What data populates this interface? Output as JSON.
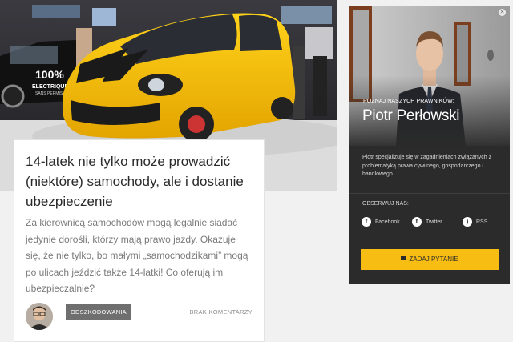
{
  "article": {
    "title": "14-latek nie tylko może prowadzić (niektóre) samochody, ale i dostanie ubezpieczenie",
    "excerpt": "Za kierownicą samochodów mogą legalnie siadać jedynie dorośli, którzy mają prawo jazdy. Okazuje się, że nie tylko, bo małymi „samochodzikami” mogą po ulicach jeździć także 14-latki! Co oferują im ubezpieczalnie?",
    "category": "ODSZKODOWANIA",
    "comments": "BRAK KOMENTARZY",
    "hero_sign": "100%",
    "hero_sign2": "ELECTRIQUE",
    "hero_sign3": "SANS PERMIS"
  },
  "widget": {
    "kicker": "POZNAJ NASZYCH PRAWNIKÓW:",
    "name": "Piotr Perłowski",
    "description": "Piotr specjalizuje się w zagadnieniach związanych z problematyką prawa cywilnego, gospodarczego i handlowego.",
    "follow_label": "OBSERWUJ NAS:",
    "social": {
      "facebook": "Facebook",
      "twitter": "Twitter",
      "rss": "RSS"
    },
    "ask_button": "ZADAJ PYTANIE"
  },
  "colors": {
    "accent": "#f7bd12",
    "widget_bg": "#2b2b2b",
    "category_bg": "#6f6f6f"
  }
}
